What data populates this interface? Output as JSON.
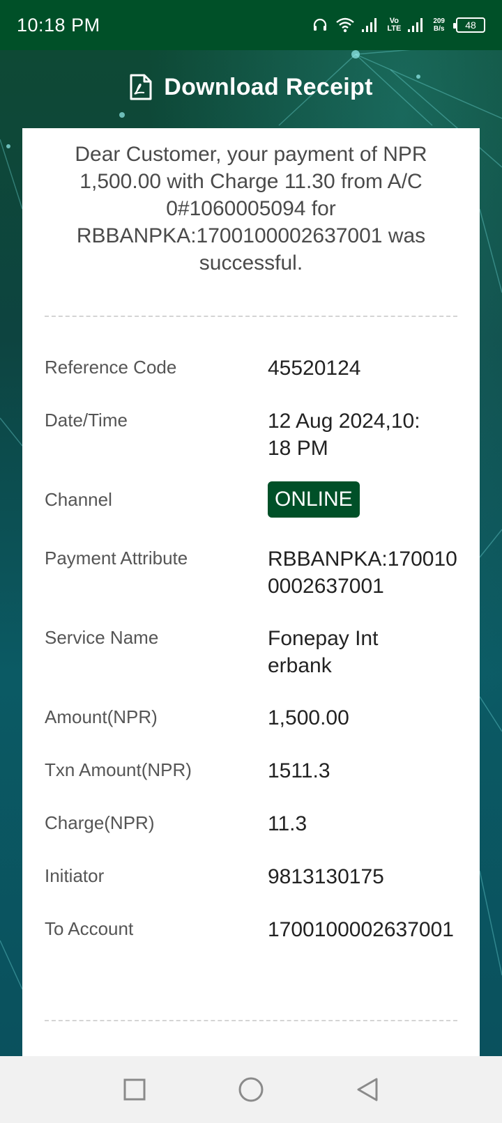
{
  "status_bar": {
    "time": "10:18 PM",
    "net_speed_value": "209",
    "net_speed_unit": "B/s",
    "volte_top": "Vo",
    "volte_bottom": "LTE",
    "battery": "48"
  },
  "header": {
    "title": "Download Receipt",
    "icon": "pdf-file-icon"
  },
  "receipt": {
    "message": "Dear Customer, your payment of NPR 1,500.00 with Charge 11.30 from A/C 0#1060005094 for RBBANPKA:1700100002637001 was successful.",
    "rows": [
      {
        "label": "Reference Code",
        "value": "45520124"
      },
      {
        "label": "Date/Time",
        "value": "12 Aug 2024,10:18 PM"
      },
      {
        "label": "Channel",
        "value": "ONLINE"
      },
      {
        "label": "Payment Attribute",
        "value": "RBBANPKA:1700100002637001"
      },
      {
        "label": "Service Name",
        "value": "Fonepay Interbank"
      },
      {
        "label": "Amount(NPR)",
        "value": "1,500.00"
      },
      {
        "label": "Txn Amount(NPR)",
        "value": "1511.3"
      },
      {
        "label": "Charge(NPR)",
        "value": "11.3"
      },
      {
        "label": "Initiator",
        "value": "9813130175"
      },
      {
        "label": "To Account",
        "value": "1700100002637001"
      }
    ]
  },
  "colors": {
    "brand_green": "#005028",
    "card_bg": "#ffffff",
    "nav_bg": "#f1f1f1"
  },
  "nav": {
    "recents": "square-icon",
    "home": "circle-icon",
    "back": "triangle-back-icon"
  }
}
